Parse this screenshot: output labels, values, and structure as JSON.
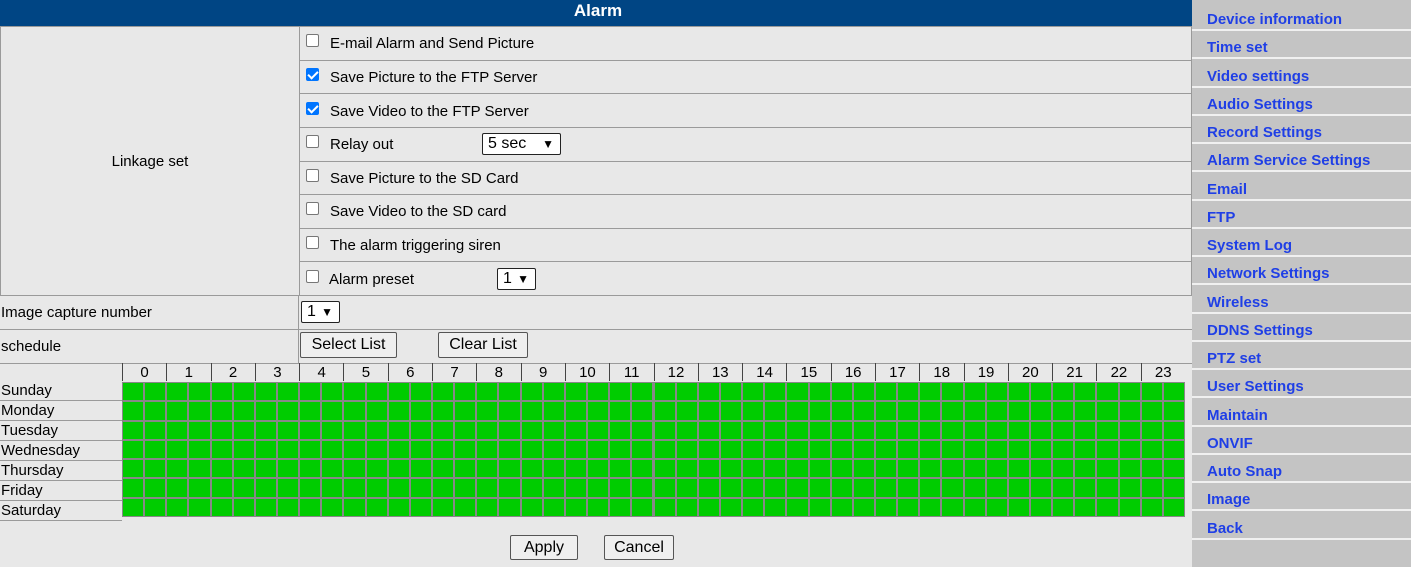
{
  "title": "Alarm",
  "linkage": {
    "label": "Linkage set",
    "options": [
      {
        "label": "E-mail Alarm and Send Picture",
        "checked": false
      },
      {
        "label": "Save Picture to the FTP Server",
        "checked": true
      },
      {
        "label": "Save Video to the FTP Server",
        "checked": true
      },
      {
        "label": "Relay out",
        "checked": false,
        "select": "5 sec"
      },
      {
        "label": "Save Picture to the SD Card",
        "checked": false
      },
      {
        "label": "Save Video to the SD card",
        "checked": false
      },
      {
        "label": "The alarm triggering siren",
        "checked": false
      },
      {
        "label": "Alarm preset",
        "checked": false,
        "select": "1"
      }
    ]
  },
  "image_capture": {
    "label": "Image capture number",
    "value": "1"
  },
  "schedule": {
    "label": "schedule",
    "select_list": "Select List",
    "clear_list": "Clear List",
    "days": [
      "Sunday",
      "Monday",
      "Tuesday",
      "Wednesday",
      "Thursday",
      "Friday",
      "Saturday"
    ],
    "hours": [
      "0",
      "1",
      "2",
      "3",
      "4",
      "5",
      "6",
      "7",
      "8",
      "9",
      "10",
      "11",
      "12",
      "13",
      "14",
      "15",
      "16",
      "17",
      "18",
      "19",
      "20",
      "21",
      "22",
      "23"
    ],
    "slots_per_hour": 2,
    "all_selected": true,
    "selected_color": "#00cc00"
  },
  "actions": {
    "apply": "Apply",
    "cancel": "Cancel"
  },
  "sidebar": {
    "items": [
      "Device information",
      "Time set",
      "Video settings",
      "Audio Settings",
      "Record Settings",
      "Alarm Service Settings",
      "Email",
      "FTP",
      "System Log",
      "Network Settings",
      "Wireless",
      "DDNS Settings",
      "PTZ set",
      "User Settings",
      "Maintain",
      "ONVIF",
      "Auto Snap",
      "Image",
      "Back"
    ]
  },
  "colors": {
    "title_bar": "#004584",
    "link": "#1f3fe6",
    "sidebar_bg": "#c4c4c4"
  }
}
